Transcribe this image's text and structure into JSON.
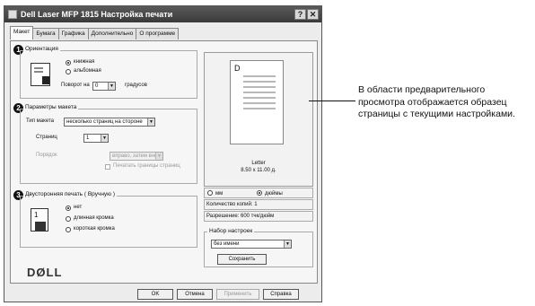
{
  "window": {
    "title": "Dell Laser MFP 1815 Настройка печати",
    "help_btn": "?",
    "close_btn": "✕"
  },
  "tabs": [
    {
      "label": "Макет",
      "active": true
    },
    {
      "label": "Бумага"
    },
    {
      "label": "Графика"
    },
    {
      "label": "Дополнительно"
    },
    {
      "label": "О программе"
    }
  ],
  "orientation": {
    "badge": "1",
    "title": "Ориентация",
    "portrait": "книжная",
    "landscape": "альбомная",
    "rotate_label": "Поворот на",
    "rotate_value": "0",
    "degrees": "градусов"
  },
  "layout": {
    "badge": "2",
    "title": "Параметры макета",
    "type_label": "Тип макета",
    "type_value": "несколько страниц на стороне",
    "pages_label": "Страниц",
    "pages_value": "1",
    "order_label": "Порядок",
    "order_value": "вправо, затем вниз",
    "borders_label": "Печатать границы страниц"
  },
  "duplex": {
    "badge": "3",
    "title": "Двусторонняя печать ( Вручную )",
    "none": "нет",
    "long": "длинная кромка",
    "short": "короткая кромка"
  },
  "preview": {
    "page_letter": "D",
    "paper_name": "Letter",
    "paper_size": "8.50 x 11.00 д."
  },
  "units": {
    "mm": "мм",
    "inch": "дюймы"
  },
  "copies": "Количество копий: 1",
  "resolution": "Разрешение: 600 тчк/дюйм",
  "presets": {
    "title": "Набор настроек",
    "value": "без имени",
    "save": "Сохранить"
  },
  "logo": "DØLL",
  "buttons": {
    "ok": "OK",
    "cancel": "Отмена",
    "apply": "Применить",
    "help": "Справка"
  },
  "callout": "В области предварительного просмотра отображается образец страницы с текущими настройками."
}
